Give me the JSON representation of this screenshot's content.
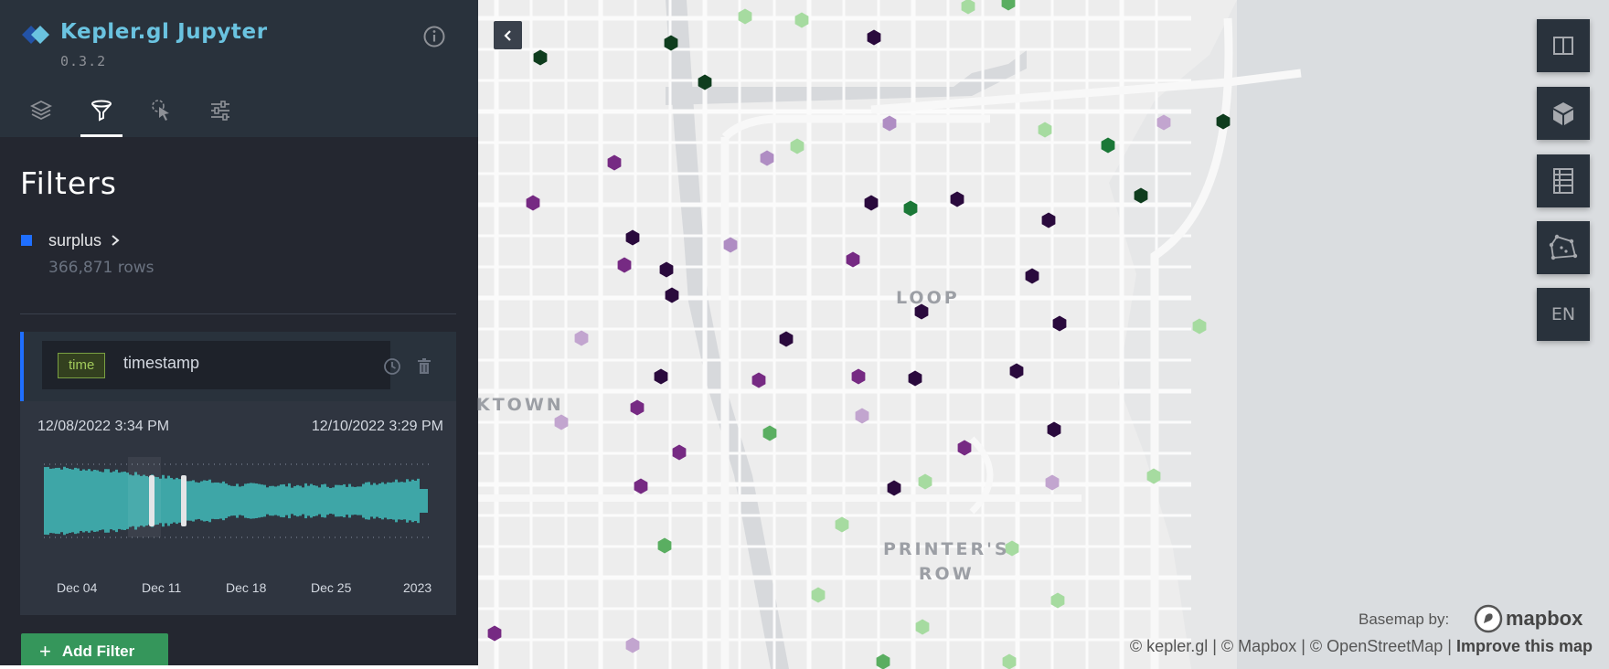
{
  "app": {
    "title": "Kepler.gl Jupyter",
    "version": "0.3.2"
  },
  "tabs": [
    {
      "name": "layers",
      "icon": "layers-icon",
      "active": false
    },
    {
      "name": "filters",
      "icon": "filter-icon",
      "active": true
    },
    {
      "name": "interactions",
      "icon": "cursor-icon",
      "active": false
    },
    {
      "name": "map-style",
      "icon": "sliders-icon",
      "active": false
    }
  ],
  "panel": {
    "title": "Filters",
    "dataset": {
      "name": "surplus",
      "rows": "366,871 rows",
      "color": "#1f6fff"
    }
  },
  "filter": {
    "type": "time",
    "field": "timestamp",
    "range_start": "12/08/2022 3:34 PM",
    "range_end": "12/10/2022 3:29 PM",
    "x_ticks": [
      "Dec 04",
      "Dec 11",
      "Dec 18",
      "Dec 25",
      "2023"
    ],
    "histogram_color": "#3ea6a7"
  },
  "add_filter_label": "Add Filter",
  "map": {
    "controls": [
      {
        "name": "split-map",
        "icon": "split-map-icon"
      },
      {
        "name": "3d-view",
        "icon": "cube-icon"
      },
      {
        "name": "legend",
        "icon": "legend-icon"
      },
      {
        "name": "draw",
        "icon": "polygon-draw-icon"
      },
      {
        "name": "locale",
        "label": "EN"
      }
    ],
    "labels": {
      "loop": "LOOP",
      "printers_row_1": "PRINTER'S",
      "printers_row_2": "ROW",
      "chinatown": "KTOWN"
    },
    "basemap_by": "Basemap by:",
    "mapbox": "mapbox",
    "attribution": {
      "kepler": "© kepler.gl",
      "mapbox": "© Mapbox",
      "osm": "© OpenStreetMap",
      "improve": "Improve this map"
    },
    "point_colors": [
      "#2a0a3d",
      "#762a83",
      "#af8dc3",
      "#c2a5cf",
      "#1b7837",
      "#5aae61",
      "#a6dba0",
      "#0f3d1e"
    ]
  }
}
